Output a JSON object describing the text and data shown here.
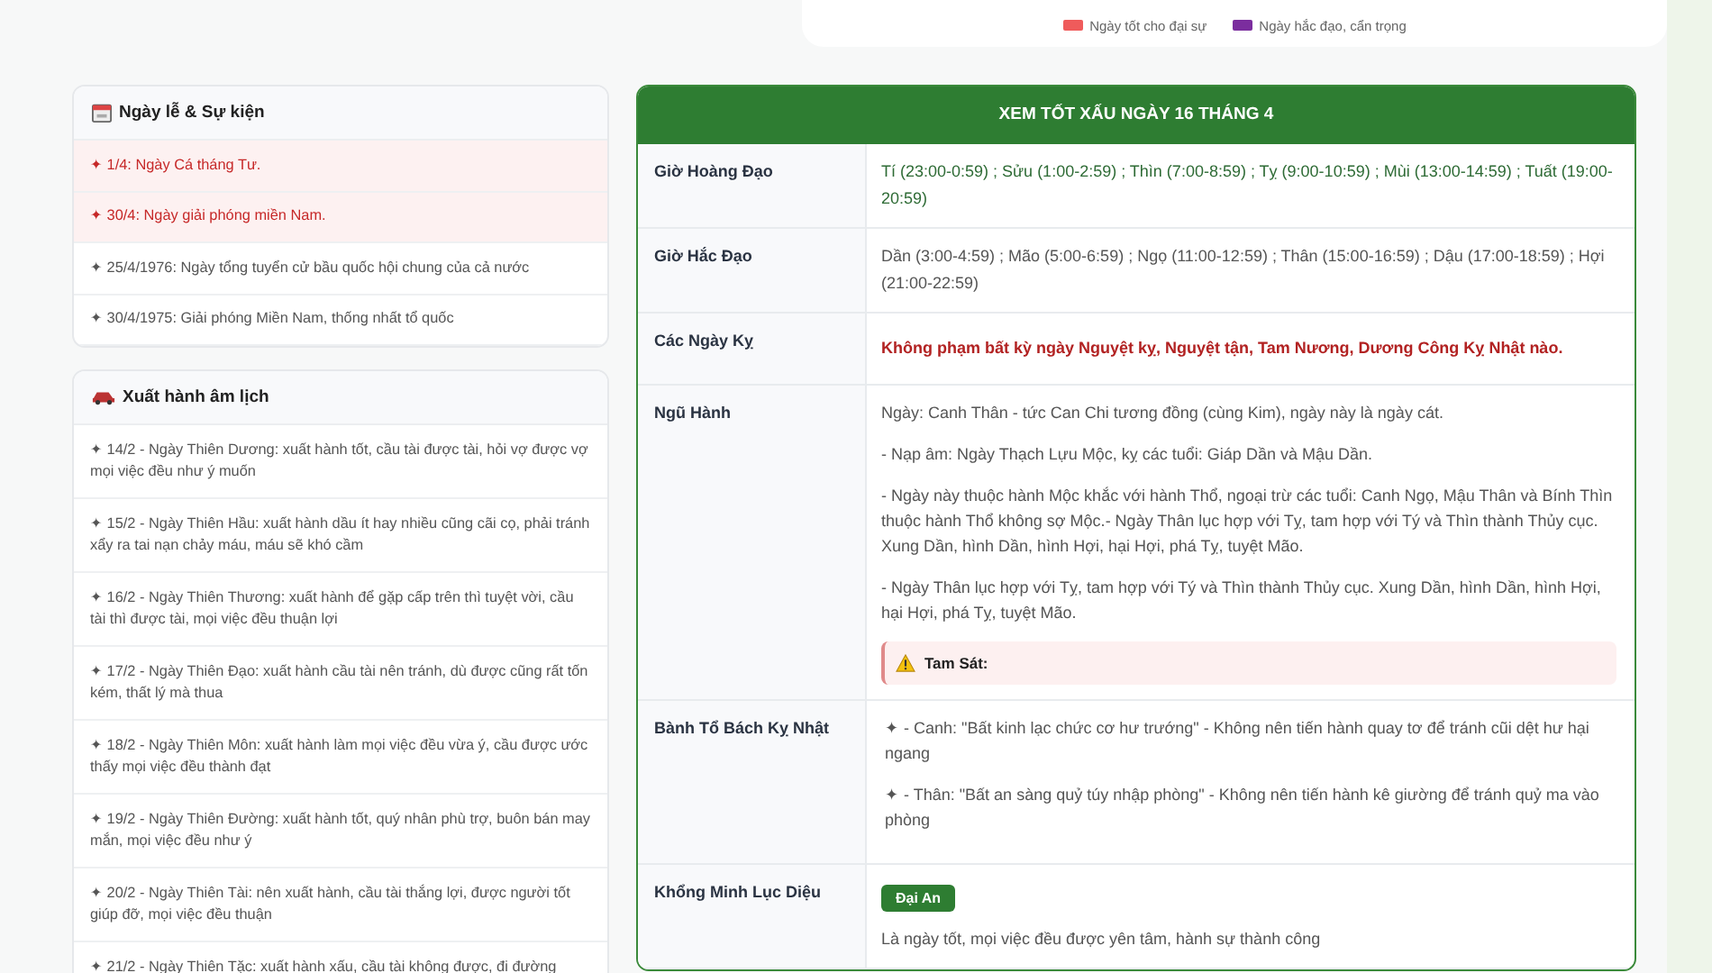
{
  "legend": [
    {
      "label": "Ngày tốt cho đại sự",
      "color": "#ef5b5b"
    },
    {
      "label": "Ngày hắc đạo, cẩn trọng",
      "color": "#7b2d9e"
    }
  ],
  "events": {
    "title": "Ngày lễ & Sự kiện",
    "items": [
      {
        "text": "✦ 1/4: Ngày Cá tháng Tư.",
        "highlighted": true
      },
      {
        "text": "✦ 30/4: Ngày giải phóng miền Nam.",
        "highlighted": true
      },
      {
        "text": "✦ 25/4/1976: Ngày tổng tuyển cử bầu quốc hội chung của cả nước",
        "highlighted": false
      },
      {
        "text": "✦ 30/4/1975: Giải phóng Miền Nam, thống nhất tổ quốc",
        "highlighted": false
      }
    ]
  },
  "travel": {
    "title": "Xuất hành âm lịch",
    "items": [
      "✦ 14/2 - Ngày Thiên Dương: xuất hành tốt, cầu tài được tài, hỏi vợ được vợ mọi việc đều như ý muốn",
      "✦ 15/2 - Ngày Thiên Hầu: xuất hành dầu ít hay nhiều cũng cãi cọ, phải tránh xẩy ra tai nạn chảy máu, máu sẽ khó cầm",
      "✦ 16/2 - Ngày Thiên Thương: xuất hành để gặp cấp trên thì tuyệt vời, cầu tài thì được tài, mọi việc đều thuận lợi",
      "✦ 17/2 - Ngày Thiên Đạo: xuất hành cầu tài nên tránh, dù được cũng rất tốn kém, thất lý mà thua",
      "✦ 18/2 - Ngày Thiên Môn: xuất hành làm mọi việc đều vừa ý, cầu được ước thấy mọi việc đều thành đạt",
      "✦ 19/2 - Ngày Thiên Đường: xuất hành tốt, quý nhân phù trợ, buôn bán may mắn, mọi việc đều như ý",
      "✦ 20/2 - Ngày Thiên Tài: nên xuất hành, cầu tài thắng lợi, được người tốt giúp đỡ, mọi việc đều thuận",
      "✦ 21/2 - Ngày Thiên Tặc: xuất hành xấu, cầu tài không được, đi đường"
    ]
  },
  "day_table": {
    "title": "XEM TỐT XẤU NGÀY 16 THÁNG 4",
    "rows": [
      {
        "kind": "good",
        "label": "Giờ Hoàng Đạo",
        "text": "Tí (23:00-0:59) ; Sửu (1:00-2:59) ; Thìn (7:00-8:59) ; Tỵ (9:00-10:59) ; Mùi (13:00-14:59) ; Tuất (19:00-20:59)"
      },
      {
        "kind": "plain",
        "label": "Giờ Hắc Đạo",
        "text": "Dần (3:00-4:59) ; Mão (5:00-6:59) ; Ngọ (11:00-12:59) ; Thân (15:00-16:59) ; Dậu (17:00-18:59) ; Hợi (21:00-22:59)"
      },
      {
        "kind": "warning",
        "label": "Các Ngày Kỵ",
        "text": "Không phạm bất kỳ ngày Nguyệt kỵ, Nguyệt tận, Tam Nương, Dương Công Kỵ Nhật nào."
      },
      {
        "kind": "paragraphs",
        "label": "Ngũ Hành",
        "paragraphs": [
          "Ngày: Canh Thân - tức Can Chi tương đồng (cùng Kim), ngày này là ngày cát.",
          "- Nạp âm: Ngày Thạch Lựu Mộc, kỵ các tuổi: Giáp Dần và Mậu Dần.",
          "- Ngày này thuộc hành Mộc khắc với hành Thổ, ngoại trừ các tuổi: Canh Ngọ, Mậu Thân và Bính Thìn thuộc hành Thổ không sợ Mộc.- Ngày Thân lục hợp với Tỵ, tam hợp với Tý và Thìn thành Thủy cục. Xung Dần, hình Dần, hình Hợi, hại Hợi, phá Tỵ, tuyệt Mão.",
          "- Ngày Thân lục hợp với Tỵ, tam hợp với Tý và Thìn thành Thủy cục. Xung Dần, hình Dần, hình Hợi, hại Hợi, phá Tỵ, tuyệt Mão."
        ],
        "alert": "Tam Sát:"
      },
      {
        "kind": "list",
        "label": "Bành Tổ Bách Kỵ Nhật",
        "paragraphs": [
          "✦ - Canh: \"Bất kinh lạc chức cơ hư trướng\" - Không nên tiến hành quay tơ để tránh cũi dệt hư hại ngang",
          "✦ - Thân: \"Bất an sàng quỷ túy nhập phòng\" - Không nên tiến hành kê giường để tránh quỷ ma vào phòng"
        ]
      },
      {
        "kind": "badge",
        "label": "Khổng Minh Lục Diệu",
        "badge": "Đại An",
        "text": "Là ngày tốt, mọi việc đều được yên tâm, hành sự thành công"
      }
    ]
  }
}
